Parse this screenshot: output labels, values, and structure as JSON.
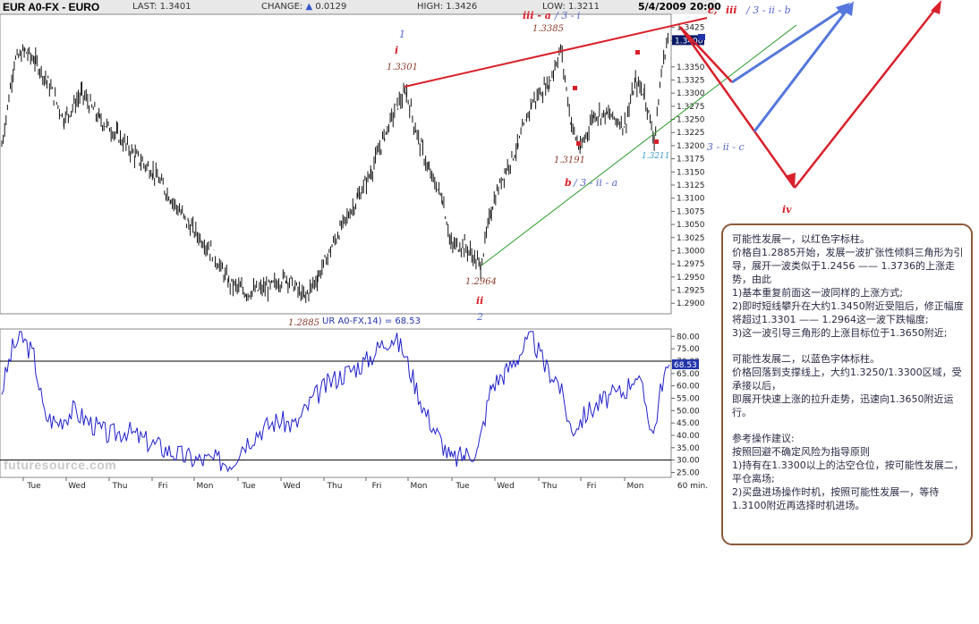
{
  "header": {
    "symbol": "EUR A0-FX - EURO",
    "last_label": "LAST:",
    "last_value": "1.3401",
    "change_label": "CHANGE:",
    "change_value": "0.0129",
    "high_label": "HIGH:",
    "high_value": "1.3426",
    "low_label": "LOW:",
    "low_value": "1.3211",
    "datetime": "5/4/2009 20:00"
  },
  "watermark": "futuresource.com",
  "chart_data": [
    {
      "type": "line",
      "subtype": "ohlc-bars",
      "title": "EUR A0-FX - EURO",
      "interval": "60 min.",
      "x_ticks": [
        "Tue",
        "Wed",
        "Thu",
        "Fri",
        "Mon",
        "Tue",
        "Wed",
        "Thu",
        "Fri",
        "Mon",
        "Tue",
        "Wed",
        "Thu",
        "Fri",
        "Mon",
        "60 min."
      ],
      "y_ticks": [
        "1.3425",
        "1.3400",
        "1.3350",
        "1.3325",
        "1.3300",
        "1.3275",
        "1.3250",
        "1.3225",
        "1.3200",
        "1.3175",
        "1.3150",
        "1.3125",
        "1.3100",
        "1.3075",
        "1.3050",
        "1.3025",
        "1.3000",
        "1.2975",
        "1.2950",
        "1.2925",
        "1.2900"
      ],
      "ylim": [
        1.288,
        1.345
      ],
      "last_marker": "1.3400",
      "series": [
        {
          "name": "EUR A0-FX",
          "points": [
            [
              0,
              1.32
            ],
            [
              14,
              1.336
            ],
            [
              26,
              1.338
            ],
            [
              38,
              1.336
            ],
            [
              52,
              1.332
            ],
            [
              70,
              1.325
            ],
            [
              90,
              1.33
            ],
            [
              110,
              1.325
            ],
            [
              130,
              1.322
            ],
            [
              150,
              1.318
            ],
            [
              170,
              1.315
            ],
            [
              190,
              1.31
            ],
            [
              210,
              1.305
            ],
            [
              235,
              1.3
            ],
            [
              255,
              1.294
            ],
            [
              275,
              1.292
            ],
            [
              300,
              1.293
            ],
            [
              320,
              1.295
            ],
            [
              340,
              1.291
            ],
            [
              355,
              1.295
            ],
            [
              380,
              1.304
            ],
            [
              400,
              1.31
            ],
            [
              415,
              1.315
            ],
            [
              430,
              1.322
            ],
            [
              445,
              1.328
            ],
            [
              455,
              1.33
            ],
            [
              465,
              1.323
            ],
            [
              480,
              1.315
            ],
            [
              495,
              1.31
            ],
            [
              505,
              1.301
            ],
            [
              520,
              1.301
            ],
            [
              538,
              1.297
            ],
            [
              550,
              1.308
            ],
            [
              565,
              1.315
            ],
            [
              580,
              1.32
            ],
            [
              595,
              1.328
            ],
            [
              615,
              1.332
            ],
            [
              628,
              1.3385
            ],
            [
              640,
              1.324
            ],
            [
              650,
              1.3191
            ],
            [
              665,
              1.326
            ],
            [
              680,
              1.326
            ],
            [
              700,
              1.324
            ],
            [
              712,
              1.332
            ],
            [
              722,
              1.33
            ],
            [
              733,
              1.3211
            ],
            [
              742,
              1.335
            ],
            [
              750,
              1.342
            ]
          ]
        }
      ],
      "price_labels": [
        "1.3301",
        "1.3385",
        "1.3191",
        "1.2964",
        "1.2885",
        "1.3211"
      ],
      "wave_labels": {
        "red": [
          "i",
          "iii - a",
          "ii",
          "b",
          "iv",
          "c,",
          "iii"
        ],
        "blue": [
          "1",
          "2",
          "/ 3 - i",
          "/ 3 - ii - a",
          "/ 3 - ii - b",
          "3 - ii - c"
        ]
      }
    },
    {
      "type": "line",
      "title": "UR A0-FX,14) = 68.53",
      "indicator_value": "68.53",
      "y_ticks": [
        "80.00",
        "75.00",
        "70.00",
        "65.00",
        "60.00",
        "55.00",
        "50.00",
        "45.00",
        "40.00",
        "35.00",
        "30.00",
        "25.00"
      ],
      "ylim": [
        23,
        83
      ],
      "ref_lines": [
        70,
        30
      ],
      "series": [
        {
          "name": "RSI",
          "points": [
            [
              0,
              58
            ],
            [
              12,
              75
            ],
            [
              22,
              80
            ],
            [
              36,
              72
            ],
            [
              48,
              48
            ],
            [
              62,
              45
            ],
            [
              80,
              50
            ],
            [
              100,
              45
            ],
            [
              120,
              40
            ],
            [
              140,
              42
            ],
            [
              160,
              38
            ],
            [
              180,
              35
            ],
            [
              200,
              32
            ],
            [
              220,
              30
            ],
            [
              240,
              30
            ],
            [
              258,
              29
            ],
            [
              270,
              36
            ],
            [
              290,
              42
            ],
            [
              310,
              46
            ],
            [
              330,
              44
            ],
            [
              350,
              55
            ],
            [
              370,
              62
            ],
            [
              390,
              66
            ],
            [
              410,
              70
            ],
            [
              425,
              76
            ],
            [
              438,
              80
            ],
            [
              450,
              75
            ],
            [
              460,
              65
            ],
            [
              475,
              50
            ],
            [
              490,
              40
            ],
            [
              505,
              30
            ],
            [
              520,
              32
            ],
            [
              535,
              34
            ],
            [
              550,
              60
            ],
            [
              565,
              65
            ],
            [
              580,
              72
            ],
            [
              595,
              80
            ],
            [
              610,
              68
            ],
            [
              625,
              62
            ],
            [
              640,
              42
            ],
            [
              660,
              50
            ],
            [
              680,
              55
            ],
            [
              700,
              58
            ],
            [
              712,
              65
            ],
            [
              722,
              55
            ],
            [
              732,
              40
            ],
            [
              742,
              62
            ],
            [
              750,
              68.53
            ]
          ]
        }
      ]
    }
  ],
  "annotation": {
    "p1": "可能性发展一，以红色字标柱。",
    "p2": "价格自1.2885开始，发展一波扩张性倾斜三角形为引导，展开一波类似于1.2456 —— 1.3736的上涨走势，由此",
    "p3": "1)基本重复前面这一波同样的上涨方式;",
    "p4": "2)即时短线攀升在大约1.3450附近受阻后，修正幅度将超过1.3301 —— 1.2964这一波下跌幅度;",
    "p5": "3)这一波引导三角形的上涨目标位于1.3650附近;",
    "p6": "可能性发展二，以蓝色字体标柱。",
    "p7": "价格回落到支撑线上，大约1.3250/1.3300区域，受承接以后，",
    "p8": "即展开快速上涨的拉升走势，迅速向1.3650附近运行。",
    "p9": "参考操作建议:",
    "p10": "按照回避不确定风险为指导原则",
    "p11": "1)持有在1.3300以上的沽空仓位，按可能性发展二，平仓离场;",
    "p12": "2)买盘进场操作时机，按照可能性发展一，等待1.3100附近再选择时机进场。"
  },
  "colors": {
    "price": "#111111",
    "rsi": "#2222cc",
    "red": "#d8202a",
    "blue": "#5577dd",
    "green": "#2a9a2a",
    "label_brown": "#8b3a2a",
    "label_blue": "#5566cc",
    "box_border": "#8b5a3c"
  }
}
